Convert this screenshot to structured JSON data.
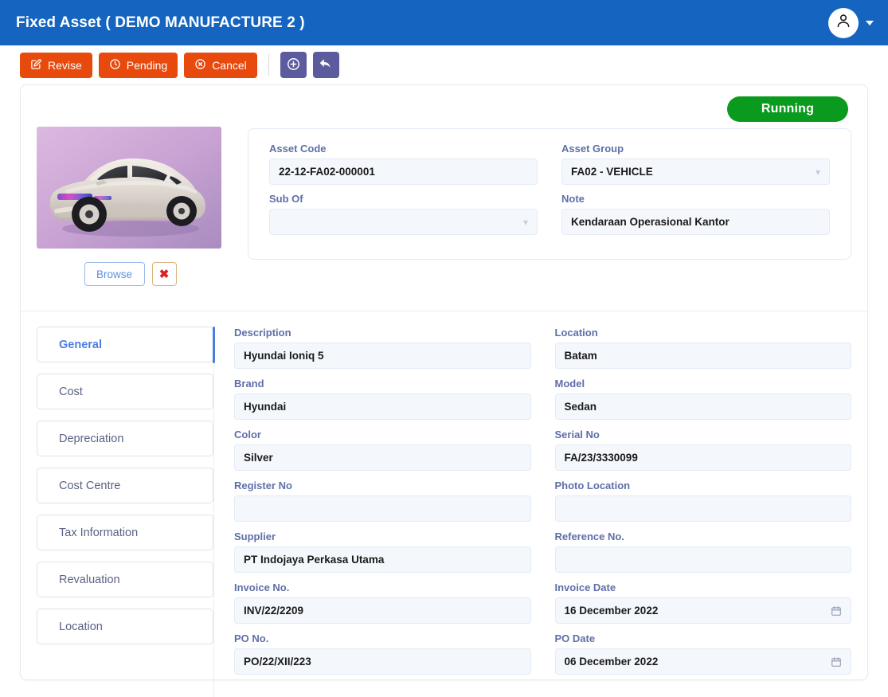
{
  "header": {
    "title": "Fixed Asset ( DEMO MANUFACTURE 2 )",
    "avatar_icon": "user-icon",
    "caret_icon": "caret-down-icon"
  },
  "toolbar": {
    "buttons": [
      {
        "label": "Revise",
        "icon": "edit-square-icon",
        "style": "orange"
      },
      {
        "label": "Pending",
        "icon": "clock-icon",
        "style": "orange"
      },
      {
        "label": "Cancel",
        "icon": "circle-x-icon",
        "style": "orange"
      }
    ],
    "icon_buttons": [
      {
        "icon": "plus-circle-icon",
        "style": "purple"
      },
      {
        "icon": "back-arrow-icon",
        "style": "purple"
      }
    ]
  },
  "status": {
    "label": "Running",
    "color": "#0A9B1E"
  },
  "thumbnail": {
    "alt": "Silver Hyundai Ioniq 5 on purple background",
    "browse_label": "Browse",
    "delete_label": "✖"
  },
  "info_panel": {
    "fields": [
      {
        "label": "Asset Code",
        "value": "22-12-FA02-000001",
        "type": "text"
      },
      {
        "label": "Asset Group",
        "value": "FA02 - VEHICLE",
        "type": "select"
      },
      {
        "label": "Sub Of",
        "value": "",
        "type": "select"
      },
      {
        "label": "Note",
        "value": "Kendaraan Operasional Kantor",
        "type": "text"
      }
    ]
  },
  "tabs": [
    {
      "label": "General",
      "active": true
    },
    {
      "label": "Cost",
      "active": false
    },
    {
      "label": "Depreciation",
      "active": false
    },
    {
      "label": "Cost Centre",
      "active": false
    },
    {
      "label": "Tax Information",
      "active": false
    },
    {
      "label": "Revaluation",
      "active": false
    },
    {
      "label": "Location",
      "active": false
    }
  ],
  "general_fields": [
    {
      "label": "Description",
      "value": "Hyundai Ioniq 5",
      "type": "text"
    },
    {
      "label": "Location",
      "value": "Batam",
      "type": "text"
    },
    {
      "label": "Brand",
      "value": "Hyundai",
      "type": "text"
    },
    {
      "label": "Model",
      "value": "Sedan",
      "type": "text"
    },
    {
      "label": "Color",
      "value": "Silver",
      "type": "text"
    },
    {
      "label": "Serial No",
      "value": "FA/23/3330099",
      "type": "text"
    },
    {
      "label": "Register No",
      "value": "",
      "type": "text"
    },
    {
      "label": "Photo Location",
      "value": "",
      "type": "text"
    },
    {
      "label": "Supplier",
      "value": "PT Indojaya Perkasa Utama",
      "type": "text"
    },
    {
      "label": "Reference No.",
      "value": "",
      "type": "text"
    },
    {
      "label": "Invoice No.",
      "value": "INV/22/2209",
      "type": "text"
    },
    {
      "label": "Invoice Date",
      "value": "16 December 2022",
      "type": "date"
    },
    {
      "label": "PO No.",
      "value": "PO/22/XII/223",
      "type": "text"
    },
    {
      "label": "PO Date",
      "value": "06 December 2022",
      "type": "date"
    }
  ]
}
